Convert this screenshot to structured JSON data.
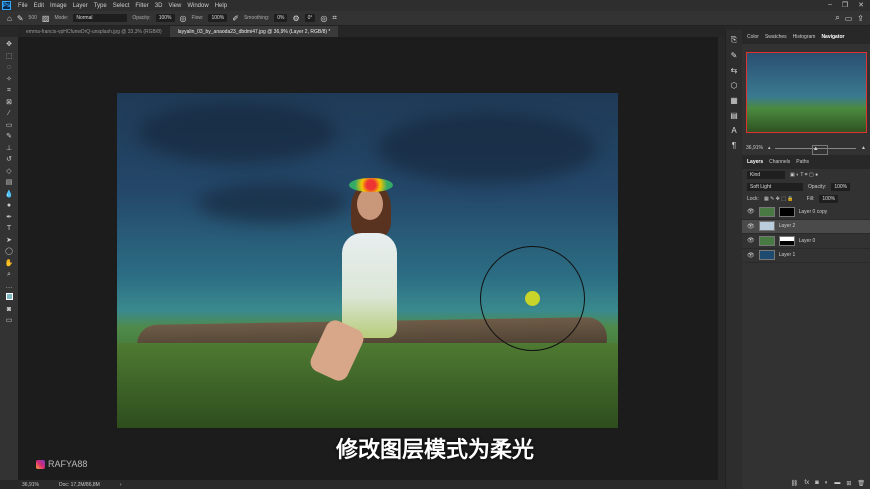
{
  "app": {
    "logo": "Ps"
  },
  "menu": [
    "File",
    "Edit",
    "Image",
    "Layer",
    "Type",
    "Select",
    "Filter",
    "3D",
    "View",
    "Window",
    "Help"
  ],
  "options": {
    "size": "500",
    "mode_label": "Mode:",
    "mode": "Normal",
    "opacity_label": "Opacity:",
    "opacity": "100%",
    "flow_label": "Flow:",
    "flow": "100%",
    "smoothing_label": "Smoothing:",
    "smoothing": "0%",
    "angle": "0°"
  },
  "tabs": [
    {
      "label": "emma-francis-vpHCfunwDrQ-unsplash.jpg @ 33,3% (RGB/8)",
      "active": false
    },
    {
      "label": "layyalin_03_by_anaoda23_dbdmi47.jpg @ 36,9% (Layer 2, RGB/8) *",
      "active": true
    }
  ],
  "canvas": {
    "subtitle": "修改图层模式为柔光",
    "watermark": "RAFYA88"
  },
  "status": {
    "zoom": "36,91%",
    "doc": "Doc: 17,2M/86,8M"
  },
  "navigator": {
    "tabs": [
      "Color",
      "Swatches",
      "Histogram",
      "Navigator"
    ],
    "active": "Navigator",
    "zoom": "36,91%",
    "frame_color": "#e03030"
  },
  "layers_panel": {
    "tabs": [
      "Layers",
      "Channels",
      "Paths"
    ],
    "active": "Layers",
    "filter": "Kind",
    "blend_mode": "Soft Light",
    "opacity_label": "Opacity:",
    "opacity": "100%",
    "lock_label": "Lock:",
    "fill_label": "Fill:",
    "fill": "100%",
    "layers": [
      {
        "name": "Layer 0 copy",
        "mask": true,
        "active": false
      },
      {
        "name": "Layer 2",
        "mask": false,
        "active": true
      },
      {
        "name": "Layer 0",
        "mask": true,
        "active": false
      },
      {
        "name": "Layer 1",
        "mask": false,
        "active": false
      }
    ]
  },
  "brush_color": "#c9d42a"
}
